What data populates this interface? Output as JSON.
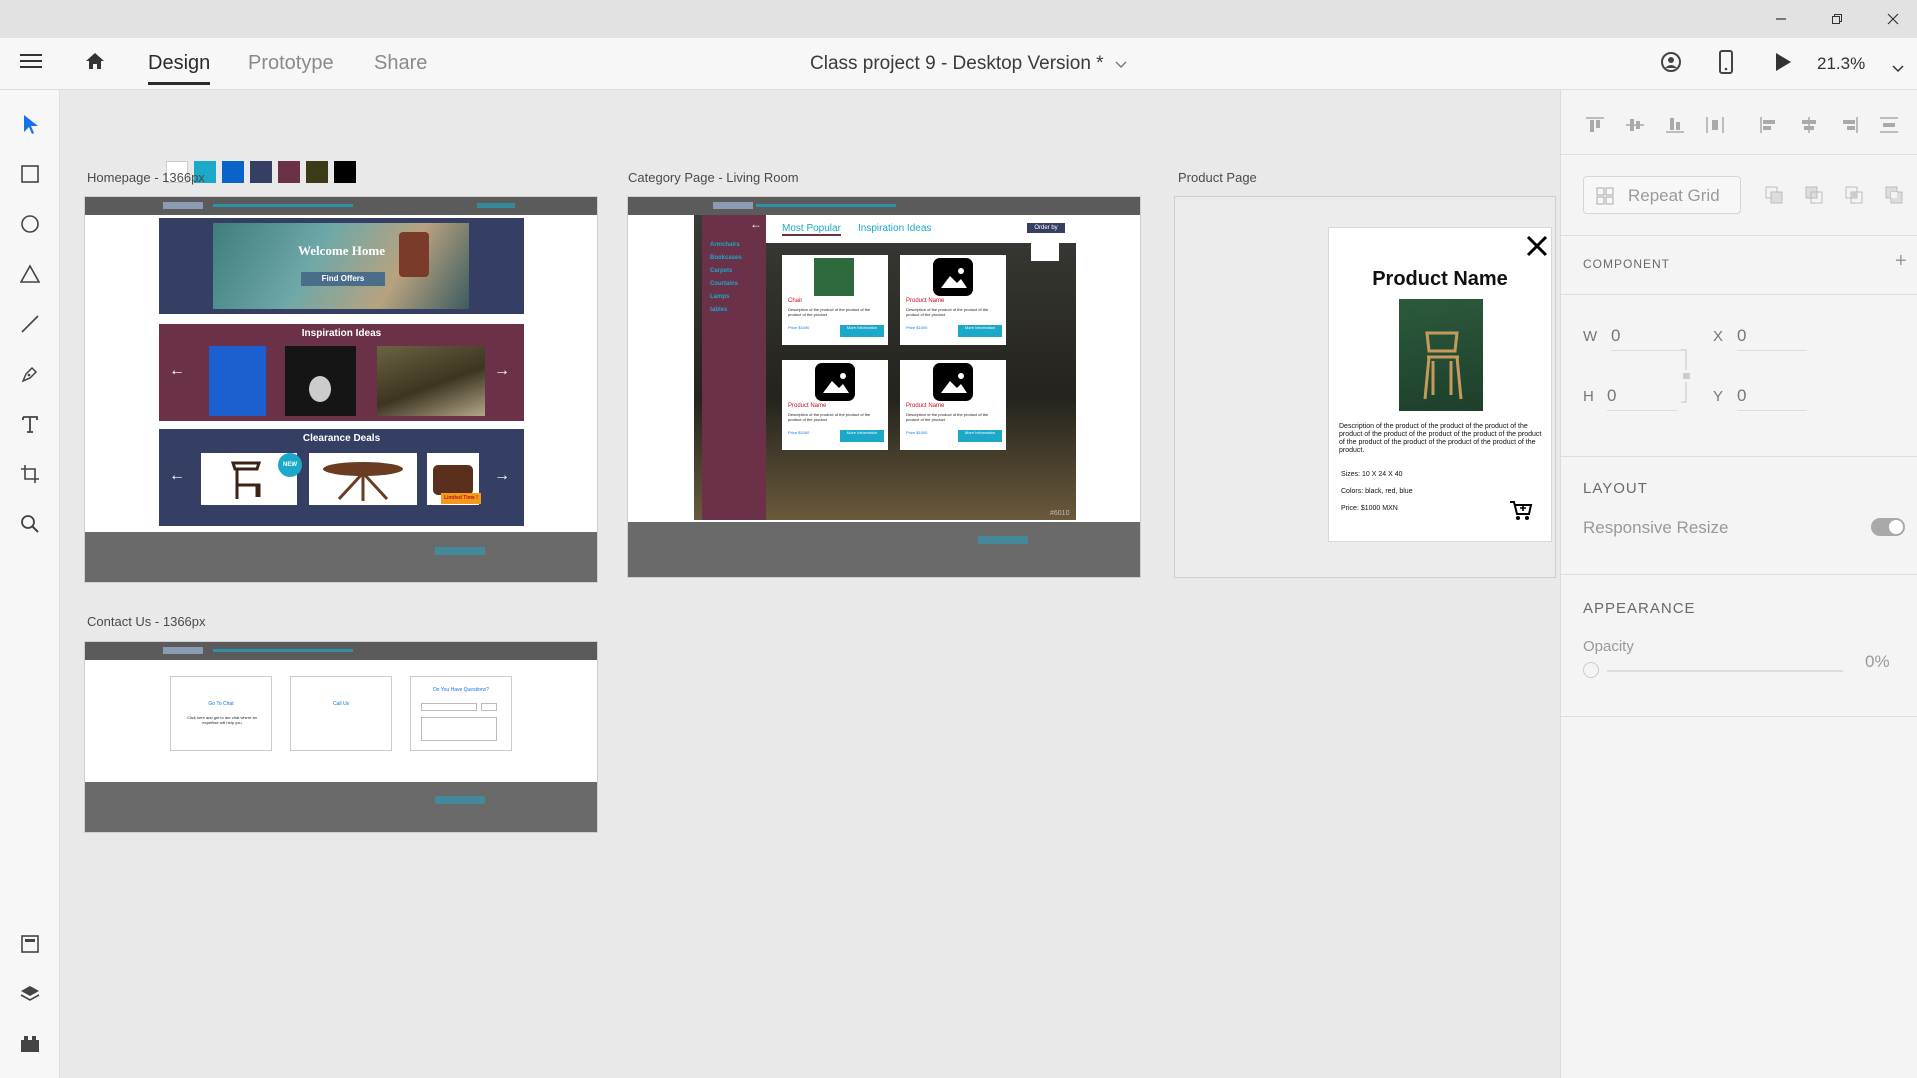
{
  "window": {
    "tabs": [
      "Design",
      "Prototype",
      "Share"
    ],
    "active_tab": "Design",
    "document_title": "Class project 9 - Desktop Version *",
    "zoom": "21.3%"
  },
  "swatches": [
    "#ffffff",
    "#1ba8c9",
    "#0a63c9",
    "#353f63",
    "#6b3149",
    "#3d3a17",
    "#000000"
  ],
  "artboards": {
    "homepage": {
      "label": "Homepage - 1366px",
      "hero_title": "Welcome Home",
      "hero_button": "Find Offers",
      "inspiration_title": "Inspiration Ideas",
      "clearance_title": "Clearance Deals",
      "new_badge": "NEW",
      "limited_badge": "Limited Time !"
    },
    "category": {
      "label": "Category Page -  Living Room",
      "tab_popular": "Most Popular",
      "tab_inspiration": "Inspiration Ideas",
      "order_by": "Order by",
      "sidebar_items": [
        "Armchairs",
        "Bookcases",
        "Carpets",
        "Courtains",
        "Lamps",
        "tables"
      ],
      "products": [
        {
          "name": "Chair",
          "desc": "Description of the product of the product of the product of the product",
          "price": "Price $1000",
          "button": "More Information"
        },
        {
          "name": "Product Name",
          "desc": "Description of the product of the product of the product of the product",
          "price": "Price $1000",
          "button": "More Information"
        },
        {
          "name": "Product Name",
          "desc": "Description of the product of the product of the product of the product",
          "price": "Price $1000",
          "button": "More Information"
        },
        {
          "name": "Product Name",
          "desc": "Description of the product of the product of the product of the product",
          "price": "Price $1000",
          "button": "More Information"
        }
      ],
      "watermark": "#6010"
    },
    "product": {
      "label": "Product Page",
      "title": "Product Name",
      "description": "Description of the product of the product of the product of the product of the product of the product of the product of the product of the product of the product of the product of the product of the product.",
      "sizes": "Sizes: 10 X 24 X 40",
      "colors": "Colors: black, red, blue",
      "price": "Price: $1000 MXN"
    },
    "contact": {
      "label": "Contact Us - 1366px",
      "card1_title": "Go To Chat",
      "card1_text": "Click here and get to are chat where an expertise will help you",
      "card2_title": "Call Us",
      "card3_title": "Do You Have Questions?"
    }
  },
  "panel": {
    "repeat_grid": "Repeat Grid",
    "component_title": "COMPONENT",
    "w_label": "W",
    "w_value": "0",
    "x_label": "X",
    "x_value": "0",
    "h_label": "H",
    "h_value": "0",
    "y_label": "Y",
    "y_value": "0",
    "layout_title": "LAYOUT",
    "responsive_resize": "Responsive Resize",
    "appearance_title": "APPEARANCE",
    "opacity_label": "Opacity",
    "opacity_value": "0%"
  }
}
